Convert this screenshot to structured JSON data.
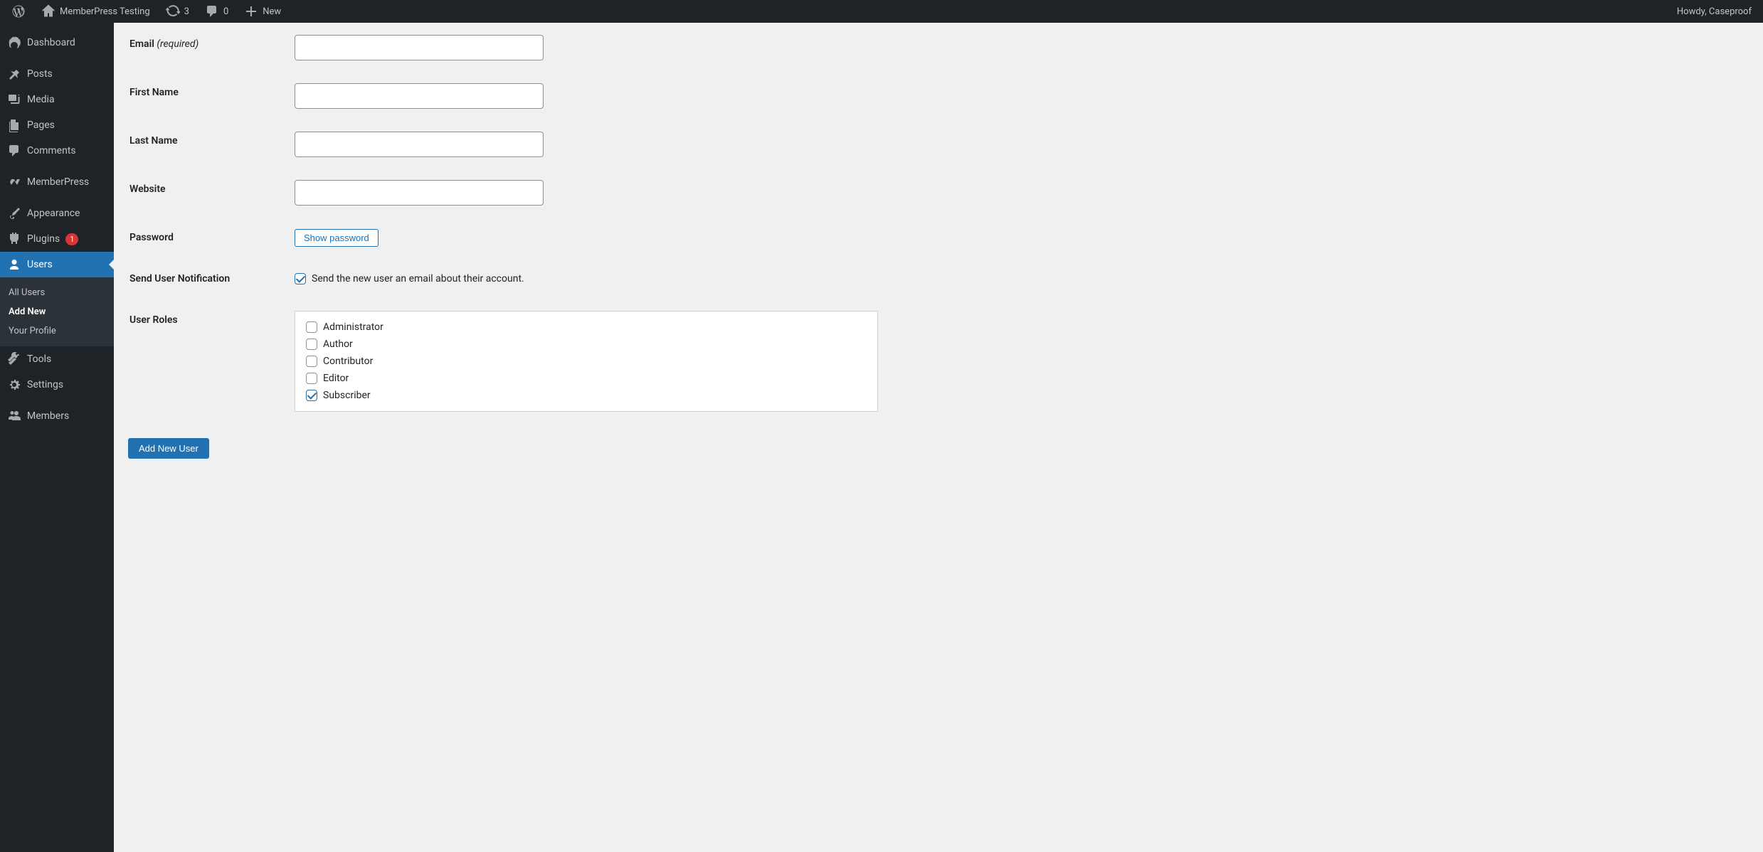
{
  "adminBar": {
    "siteName": "MemberPress Testing",
    "updateCount": "3",
    "commentCount": "0",
    "newLabel": "New",
    "howdy": "Howdy, Caseproof"
  },
  "sidebar": {
    "dashboard": "Dashboard",
    "posts": "Posts",
    "media": "Media",
    "pages": "Pages",
    "comments": "Comments",
    "memberpress": "MemberPress",
    "appearance": "Appearance",
    "plugins": "Plugins",
    "pluginsBadge": "1",
    "users": "Users",
    "tools": "Tools",
    "settings": "Settings",
    "members": "Members"
  },
  "submenu": {
    "allUsers": "All Users",
    "addNew": "Add New",
    "yourProfile": "Your Profile"
  },
  "form": {
    "emailLabel": "Email",
    "requiredText": "(required)",
    "firstName": "First Name",
    "lastName": "Last Name",
    "website": "Website",
    "password": "Password",
    "showPassword": "Show password",
    "sendNotification": "Send User Notification",
    "sendNotificationDesc": "Send the new user an email about their account.",
    "userRoles": "User Roles",
    "roles": {
      "administrator": "Administrator",
      "author": "Author",
      "contributor": "Contributor",
      "editor": "Editor",
      "subscriber": "Subscriber"
    },
    "submit": "Add New User"
  }
}
